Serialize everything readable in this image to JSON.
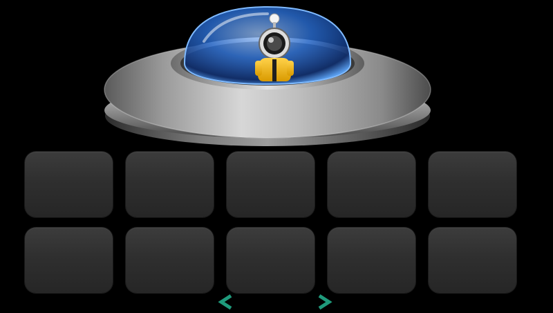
{
  "screen": {
    "background": "#000000"
  },
  "ufo": {
    "icon": "ufo-with-astronaut",
    "colors": {
      "hull": "#a9a9a9",
      "dome": "#2f74d8",
      "astronaut_suit": "#f2b71c"
    }
  },
  "slots": {
    "rows": 2,
    "columns": 5,
    "items": [
      {
        "state": "empty"
      },
      {
        "state": "empty"
      },
      {
        "state": "empty"
      },
      {
        "state": "empty"
      },
      {
        "state": "empty"
      },
      {
        "state": "empty"
      },
      {
        "state": "empty"
      },
      {
        "state": "empty"
      },
      {
        "state": "empty"
      },
      {
        "state": "empty"
      }
    ],
    "color": "#333333"
  },
  "pager": {
    "prev_icon": "chevron-left-icon",
    "next_icon": "chevron-right-icon",
    "color": "#1f9a7c"
  }
}
